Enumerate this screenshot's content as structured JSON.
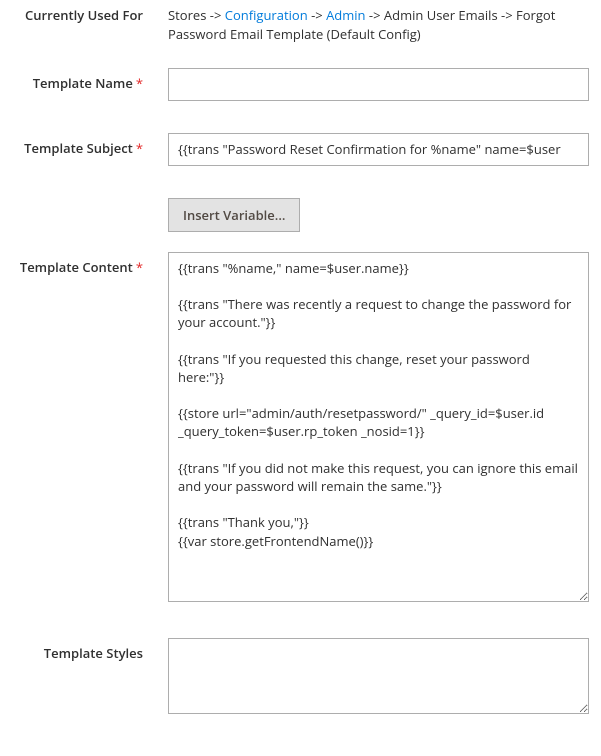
{
  "currently_used_for": {
    "label": "Currently Used For",
    "prefix": "Stores -> ",
    "link1": "Configuration",
    "sep1": " -> ",
    "link2": "Admin",
    "suffix": " -> Admin User Emails -> Forgot Password Email Template  (Default Config)"
  },
  "fields": {
    "template_name": {
      "label": "Template Name",
      "value": ""
    },
    "template_subject": {
      "label": "Template Subject",
      "value": "{{trans \"Password Reset Confirmation for %name\" name=$user"
    },
    "insert_variable_button": "Insert Variable...",
    "template_content": {
      "label": "Template Content",
      "value": "{{trans \"%name,\" name=$user.name}}\n\n{{trans \"There was recently a request to change the password for your account.\"}}\n\n{{trans \"If you requested this change, reset your password here:\"}}\n\n{{store url=\"admin/auth/resetpassword/\" _query_id=$user.id _query_token=$user.rp_token _nosid=1}}\n\n{{trans \"If you did not make this request, you can ignore this email and your password will remain the same.\"}}\n\n{{trans \"Thank you,\"}}\n{{var store.getFrontendName()}}"
    },
    "template_styles": {
      "label": "Template Styles",
      "value": ""
    }
  }
}
